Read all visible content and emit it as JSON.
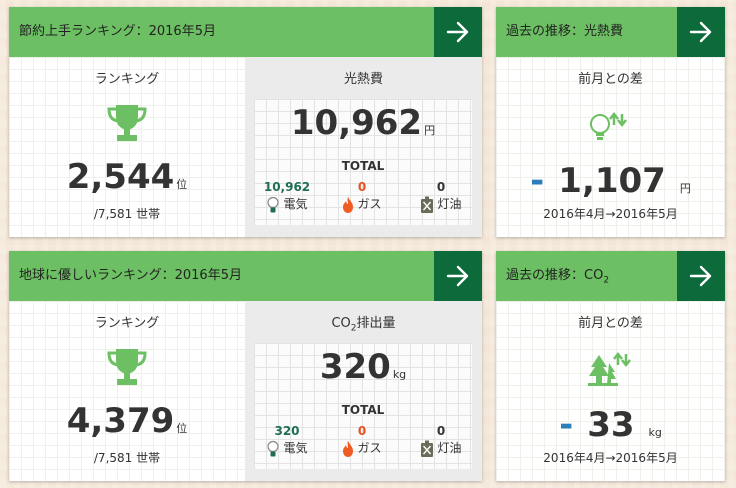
{
  "colors": {
    "header": "#6cc063",
    "arrow": "#0d6b3b",
    "accent_icon": "#6cc063",
    "electric_value": "#1f6e53",
    "gas_value": "#e8501e",
    "kerosene_value": "#333333",
    "minus_sign": "#2a7fb8"
  },
  "ranking_cost": {
    "title": "節約上手ランキング：2016年5月",
    "rank_label": "ランキング",
    "rank_value": "2,544",
    "rank_unit": "位",
    "rank_total": "/7,581 世帯",
    "total_cost_label": "光熱費",
    "total_value": "10,962",
    "total_unit": "円",
    "total_caption": "TOTAL",
    "utilities": [
      {
        "name": "電気",
        "value": "10,962",
        "icon": "lightbulb-icon"
      },
      {
        "name": "ガス",
        "value": "0",
        "icon": "flame-icon"
      },
      {
        "name": "灯油",
        "value": "0",
        "icon": "fuel-can-icon"
      }
    ]
  },
  "history_cost": {
    "title": "過去の推移：光熱費",
    "diff_label": "前月との差",
    "sign": "-",
    "value": "1,107",
    "unit": "円",
    "period": "2016年4月→2016年5月"
  },
  "ranking_eco": {
    "title": "地球に優しいランキング：2016年5月",
    "rank_label": "ランキング",
    "rank_value": "4,379",
    "rank_unit": "位",
    "rank_total": "/7,581 世帯",
    "emission_label_pre": "CO",
    "emission_label_sub": "2",
    "emission_label_post": "排出量",
    "total_value": "320",
    "total_unit": "kg",
    "total_caption": "TOTAL",
    "utilities": [
      {
        "name": "電気",
        "value": "320",
        "icon": "lightbulb-icon"
      },
      {
        "name": "ガス",
        "value": "0",
        "icon": "flame-icon"
      },
      {
        "name": "灯油",
        "value": "0",
        "icon": "fuel-can-icon"
      }
    ]
  },
  "history_co2": {
    "title_pre": "過去の推移：CO",
    "title_sub": "2",
    "diff_label": "前月との差",
    "sign": "-",
    "value": "33",
    "unit": "kg",
    "period": "2016年4月→2016年5月"
  }
}
